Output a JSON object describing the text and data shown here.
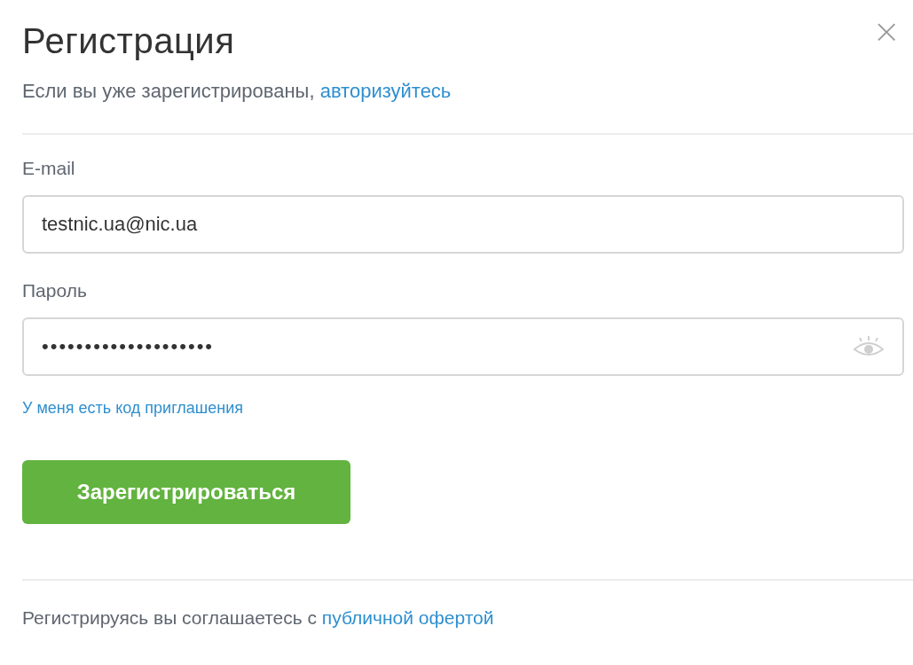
{
  "title": "Регистрация",
  "close_button": {
    "label": "×"
  },
  "login_hint": {
    "text": "Если вы уже зарегистрированы, ",
    "link": "авторизуйтесь"
  },
  "fields": [
    {
      "label": "E-mail",
      "value": "testnic.ua@nic.ua",
      "kind": "text"
    },
    {
      "label": "Пароль",
      "value": "••••••••••••••••••••",
      "kind": "password"
    }
  ],
  "invite_link": "У меня есть код приглашения",
  "submit_button": "Зарегистрироваться",
  "footer": {
    "text": "Регистрируясь вы соглашаетесь с ",
    "link": "публичной офертой"
  }
}
